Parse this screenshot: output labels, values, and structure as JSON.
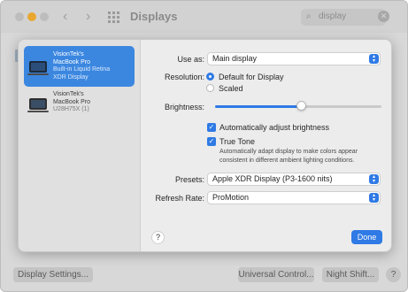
{
  "window": {
    "title": "Displays",
    "search_value": "display",
    "footer": {
      "display_settings": "Display Settings...",
      "universal_control": "Universal Control...",
      "night_shift": "Night Shift...",
      "help": "?"
    }
  },
  "sidebar": {
    "displays": [
      {
        "lines": [
          "VisionTek's",
          "MacBook Pro"
        ],
        "sub": [
          "Built-in Liquid Retina",
          "XDR Display"
        ],
        "selected": true
      },
      {
        "lines": [
          "VisionTek's",
          "MacBook Pro"
        ],
        "sub": [
          "U28H75X (1)"
        ],
        "selected": false
      }
    ]
  },
  "settings": {
    "use_as_label": "Use as:",
    "use_as_value": "Main display",
    "resolution_label": "Resolution:",
    "resolution_options": [
      "Default for Display",
      "Scaled"
    ],
    "resolution_selected": "Default for Display",
    "brightness_label": "Brightness:",
    "brightness_level": 0.52,
    "auto_brightness_label": "Automatically adjust brightness",
    "auto_brightness_checked": true,
    "true_tone_label": "True Tone",
    "true_tone_checked": true,
    "true_tone_note": "Automatically adapt display to make colors appear consistent in different ambient lighting conditions.",
    "presets_label": "Presets:",
    "presets_value": "Apple XDR Display (P3-1600 nits)",
    "refresh_label": "Refresh Rate:",
    "refresh_value": "ProMotion",
    "help": "?",
    "done": "Done"
  },
  "colors": {
    "accent": "#2f7ae5",
    "selection": "#3b87e0"
  }
}
